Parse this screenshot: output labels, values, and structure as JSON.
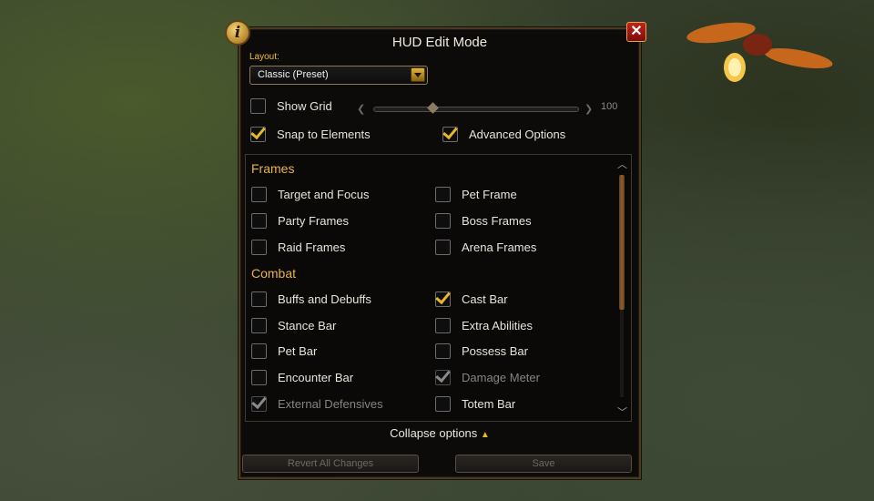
{
  "window": {
    "title": "HUD Edit Mode",
    "info_icon": "i",
    "close_icon": "✕"
  },
  "layout": {
    "label": "Layout:",
    "selected": "Classic (Preset)"
  },
  "options": {
    "show_grid": {
      "label": "Show Grid",
      "checked": false
    },
    "grid_slider_value": "100",
    "snap_to_elements": {
      "label": "Snap to Elements",
      "checked": true
    },
    "advanced_options": {
      "label": "Advanced Options",
      "checked": true
    }
  },
  "sections": [
    {
      "title": "Frames",
      "items": [
        {
          "label": "Target and Focus",
          "checked": false,
          "disabled": false
        },
        {
          "label": "Pet Frame",
          "checked": false,
          "disabled": false
        },
        {
          "label": "Party Frames",
          "checked": false,
          "disabled": false
        },
        {
          "label": "Boss Frames",
          "checked": false,
          "disabled": false
        },
        {
          "label": "Raid Frames",
          "checked": false,
          "disabled": false
        },
        {
          "label": "Arena Frames",
          "checked": false,
          "disabled": false
        }
      ]
    },
    {
      "title": "Combat",
      "items": [
        {
          "label": "Buffs and Debuffs",
          "checked": false,
          "disabled": false
        },
        {
          "label": "Cast Bar",
          "checked": true,
          "disabled": false
        },
        {
          "label": "Stance Bar",
          "checked": false,
          "disabled": false
        },
        {
          "label": "Extra Abilities",
          "checked": false,
          "disabled": false
        },
        {
          "label": "Pet Bar",
          "checked": false,
          "disabled": false
        },
        {
          "label": "Possess Bar",
          "checked": false,
          "disabled": false
        },
        {
          "label": "Encounter Bar",
          "checked": false,
          "disabled": false
        },
        {
          "label": "Damage Meter",
          "checked": true,
          "disabled": true
        },
        {
          "label": "External Defensives",
          "checked": true,
          "disabled": true
        },
        {
          "label": "Totem Bar",
          "checked": false,
          "disabled": false
        }
      ]
    }
  ],
  "footer": {
    "collapse_label": "Collapse options",
    "collapse_arrow": "▲",
    "revert_label": "Revert All Changes",
    "save_label": "Save"
  },
  "colors": {
    "accent_gold": "#e7b449",
    "check_gold": "#e8b829",
    "close_red": "#c4221a"
  }
}
